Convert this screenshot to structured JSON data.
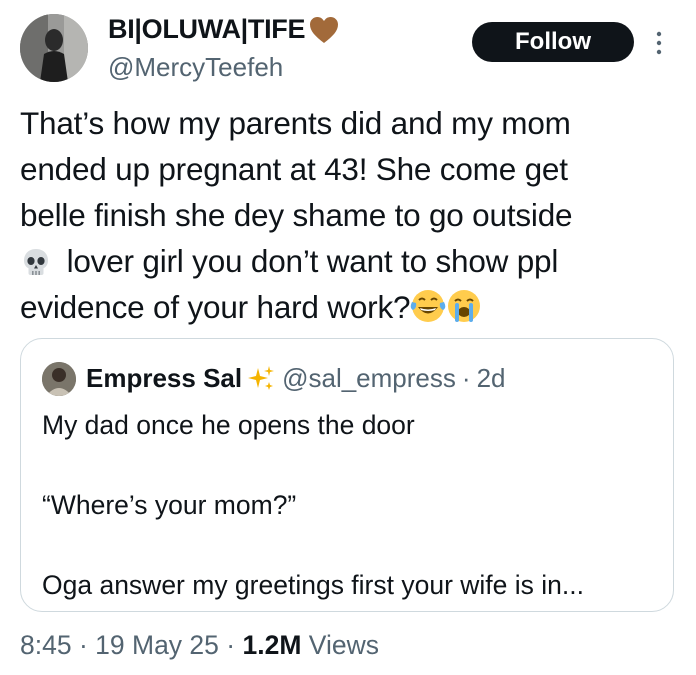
{
  "author": {
    "display_name": "BI|OLUWA|TIFE",
    "handle": "@MercyTeefeh"
  },
  "follow_button": {
    "label": "Follow"
  },
  "tweet": {
    "lines": [
      "That’s how my parents did and my mom",
      "ended up pregnant at 43! She come get",
      "belle finish she dey shame to go outside",
      "lover girl you don’t want to show ppl",
      "evidence of your hard work?"
    ],
    "emojis": [
      "skull",
      "face-with-tears-of-joy",
      "loudly-crying-face"
    ]
  },
  "quoted_tweet": {
    "name": "Empress Sal",
    "handle": "@sal_empress",
    "separator": "·",
    "time": "2d",
    "lines": [
      "My dad once he opens the door",
      "",
      "“Where’s your mom?”",
      "",
      "Oga answer my greetings first your wife is in..."
    ]
  },
  "meta": {
    "time": "8:45",
    "sep1": "·",
    "date": "19 May 25",
    "sep2": "·",
    "views_count": "1.2M",
    "views_label": "Views"
  },
  "colors": {
    "text": "#0f1419",
    "secondary": "#536471",
    "border": "#cfd9de",
    "button_bg": "#0f1419",
    "heart": "#a26a3a",
    "sparkle": "#f5b400"
  }
}
